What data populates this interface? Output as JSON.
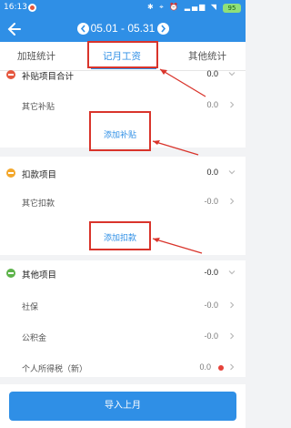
{
  "status_bar": {
    "time": "16:13",
    "right_icons": "✱ ⌖ ⏰ ▂▄▆ ◥",
    "battery": "95"
  },
  "header": {
    "period": "05.01 - 05.31"
  },
  "tabs": [
    {
      "label": "加班统计",
      "active": false
    },
    {
      "label": "记月工资",
      "active": true
    },
    {
      "label": "其他统计",
      "active": false
    }
  ],
  "subsidy": {
    "title": "补贴项目合计",
    "total": "0.0",
    "items": [
      {
        "label": "其它补贴",
        "value": "0.0"
      }
    ],
    "add_label": "添加补贴"
  },
  "deductions": {
    "title": "扣款项目",
    "total": "0.0",
    "items": [
      {
        "label": "其它扣款",
        "value": "-0.0"
      }
    ],
    "add_label": "添加扣款"
  },
  "others": {
    "title": "其他项目",
    "total": "-0.0",
    "items": [
      {
        "label": "社保",
        "value": "-0.0"
      },
      {
        "label": "公积金",
        "value": "-0.0"
      },
      {
        "label": "个人所得税（新）",
        "value": "0.0"
      }
    ]
  },
  "footer": {
    "import_label": "导入上月"
  },
  "colors": {
    "accent": "#2f8fe6",
    "annotation": "#d9342b",
    "subsidy_dot": "#e5573f",
    "deduction_dot": "#f3a72b",
    "other_dot": "#5db34a"
  }
}
